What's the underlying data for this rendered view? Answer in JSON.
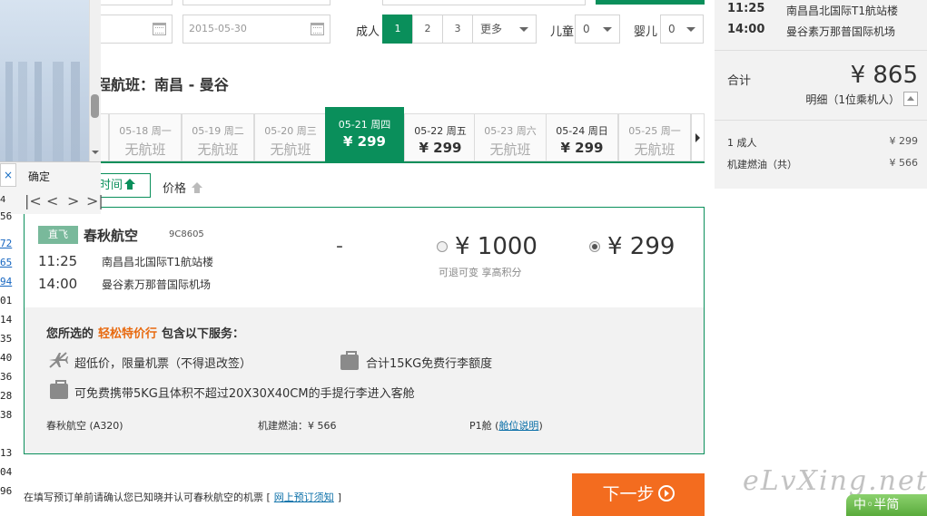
{
  "search": {
    "depart_date": "",
    "return_date": "2015-05-30",
    "adult_label": "成人",
    "adult_options": [
      "1",
      "2",
      "3"
    ],
    "adult_more": "更多",
    "child_label": "儿童",
    "child_value": "0",
    "infant_label": "婴儿",
    "infant_value": "0"
  },
  "route_title": "程航班：南昌 - 曼谷",
  "date_strip": [
    {
      "date": "",
      "price": ""
    },
    {
      "date": "05-18 周一",
      "price": "无航班"
    },
    {
      "date": "05-19 周二",
      "price": "无航班"
    },
    {
      "date": "05-20 周三",
      "price": "无航班"
    },
    {
      "date": "05-21 周四",
      "price": "¥ 299",
      "active": true
    },
    {
      "date": "05-22 周五",
      "price": "¥ 299"
    },
    {
      "date": "05-23 周六",
      "price": "无航班"
    },
    {
      "date": "05-24 周日",
      "price": "¥ 299"
    },
    {
      "date": "05-25 周一",
      "price": "无航班"
    }
  ],
  "sort": {
    "time_label": "时间",
    "price_label": "价格"
  },
  "flight": {
    "badge": "直飞",
    "airline": "春秋航空",
    "flight_no": "9C8605",
    "dep_time": "11:25",
    "dep_airport": "南昌昌北国际T1航站楼",
    "arr_time": "14:00",
    "arr_airport": "曼谷素万那普国际机场",
    "dash": "-",
    "fare_flex": "¥ 1000",
    "fare_flex_note": "可退可变 享高积分",
    "fare_budget": "¥ 299"
  },
  "services": {
    "title_pre": "您所选的",
    "title_highlight": "轻松特价行",
    "title_post": "包含以下服务：",
    "item1": "超低价，限量机票（不得退改签）",
    "item2": "合计15KG免费行李额度",
    "item3": "可免费携带5KG且体积不超过20X30X40CM的手提行李进入客舱",
    "aircraft": "春秋航空 (A320)",
    "fuel": "机建燃油：¥ 566",
    "cabin": "P1舱",
    "cabin_link": "舱位说明"
  },
  "agreement": {
    "text_pre": "在填写预订单前请确认您已知晓并认可春秋航空的机票 [",
    "link": "网上预订须知",
    "text_post": "]"
  },
  "next_button": "下一步",
  "summary": {
    "dep_time": "11:25",
    "dep_airport": "南昌昌北国际T1航站楼",
    "arr_time": "14:00",
    "arr_airport": "曼谷素万那普国际机场",
    "total_label": "合计",
    "total_value": "¥ 865",
    "detail": "明细（1位乘机人）",
    "row1_label": "1 成人",
    "row1_value": "¥ 299",
    "row2_label": "机建燃油（共）",
    "row2_value": "¥ 566"
  },
  "overlay": {
    "close": "×",
    "ok": "确定",
    "page_num": "4",
    "gutter_lines": [
      "56",
      "72",
      "65",
      "94",
      "01",
      "14",
      "35",
      "40",
      "28",
      "36",
      "38",
      "13",
      "04",
      "96"
    ]
  },
  "watermark": "eLvXing.net",
  "ime": "中◦半简",
  "colors": {
    "brand_green": "#0a8f5b",
    "accent_orange": "#f36c1f",
    "highlight_orange": "#e86a10",
    "link_blue": "#0a6fa8"
  }
}
